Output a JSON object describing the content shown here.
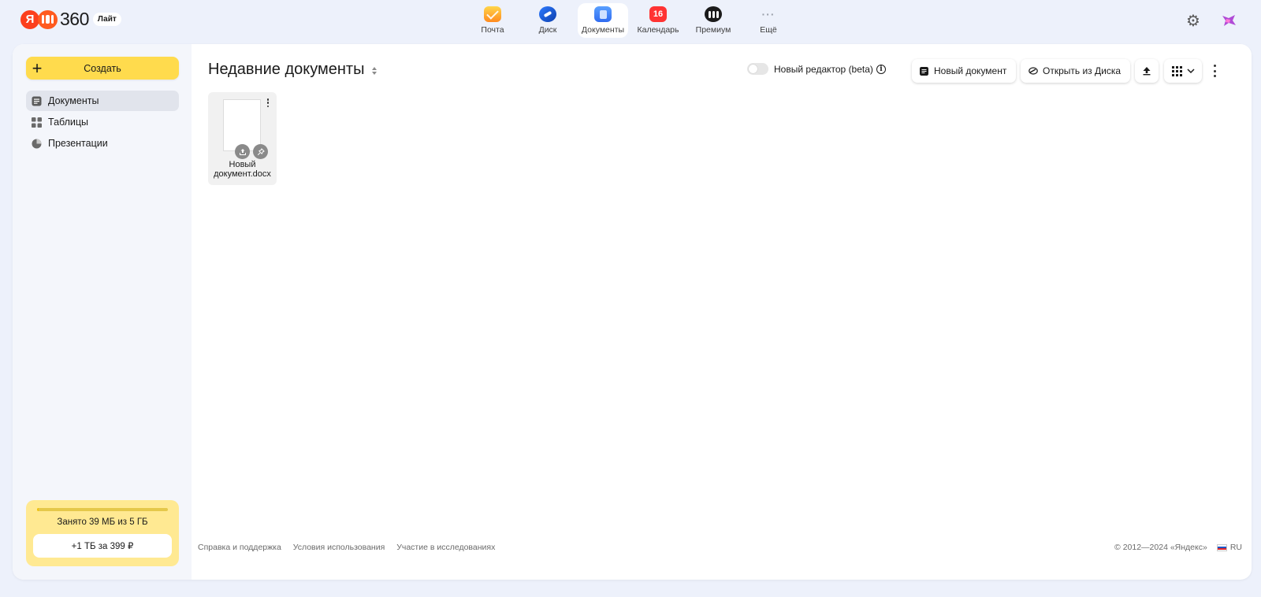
{
  "logo": {
    "ya": "Я",
    "number": "360",
    "badge": "Лайт"
  },
  "services": [
    {
      "label": "Почта",
      "icon": "mail-icon"
    },
    {
      "label": "Диск",
      "icon": "disk-icon"
    },
    {
      "label": "Документы",
      "icon": "documents-icon",
      "active": true
    },
    {
      "label": "Календарь",
      "icon": "calendar-icon",
      "badge": "16"
    },
    {
      "label": "Премиум",
      "icon": "premium-icon"
    },
    {
      "label": "Ещё",
      "icon": "more-icon",
      "glyph": "···"
    }
  ],
  "sidebar": {
    "create_label": "Создать",
    "items": [
      {
        "label": "Документы",
        "icon": "document-icon",
        "active": true
      },
      {
        "label": "Таблицы",
        "icon": "table-icon"
      },
      {
        "label": "Презентации",
        "icon": "presentation-icon"
      }
    ],
    "storage": {
      "text": "Занято 39 МБ из 5 ГБ",
      "used_fraction": 0.008,
      "button": "+1 ТБ за 399 ₽"
    }
  },
  "main": {
    "title": "Недавние документы",
    "toggle_label": "Новый редактор (beta)",
    "info_glyph": "i",
    "toggle_on": false,
    "buttons": {
      "new_doc": "Новый документ",
      "open_disk": "Открыть из Диска"
    },
    "documents": [
      {
        "name_line1": "Новый",
        "name_line2": "документ.docx"
      }
    ]
  },
  "footer": {
    "links": [
      "Справка и поддержка",
      "Условия использования",
      "Участие в исследованиях"
    ],
    "copyright": "© 2012—2024 «Яндекс»",
    "lang": "RU"
  },
  "colors": {
    "background": "#edf1fb",
    "accent_yellow": "#ffdb4d",
    "storage_bg": "#ffe992",
    "active_nav": "#e1e4ec"
  }
}
